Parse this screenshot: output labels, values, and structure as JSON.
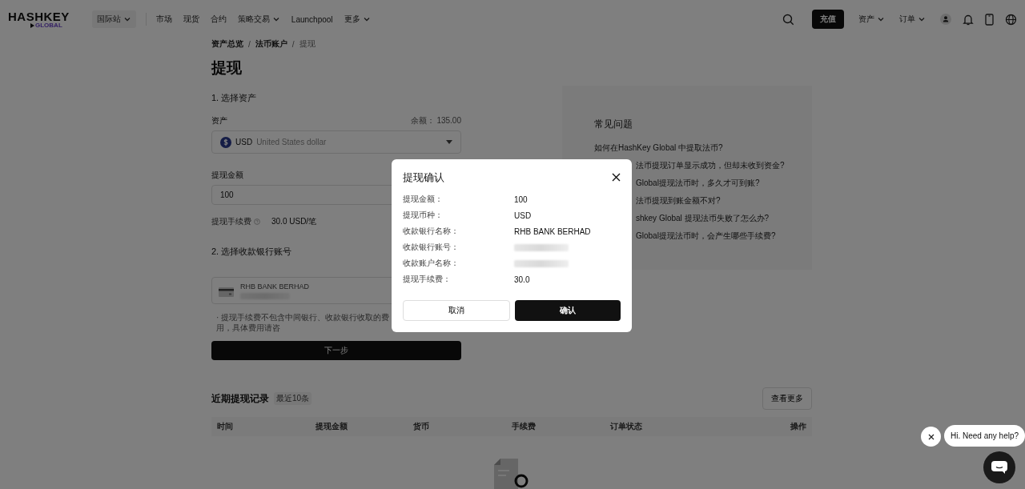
{
  "header": {
    "logo": "HASHKEY",
    "logo_sub": "GLOBAL",
    "site": "国际站",
    "nav": [
      {
        "label": "市场",
        "dropdown": false
      },
      {
        "label": "现货",
        "dropdown": false
      },
      {
        "label": "合约",
        "dropdown": false
      },
      {
        "label": "策略交易",
        "dropdown": true
      },
      {
        "label": "Launchpool",
        "dropdown": false
      },
      {
        "label": "更多",
        "dropdown": true
      }
    ],
    "deposit": "充值",
    "menus": [
      {
        "label": "资产"
      },
      {
        "label": "订单"
      }
    ]
  },
  "breadcrumb": [
    {
      "label": "资产总览",
      "current": false
    },
    {
      "label": "法币账户",
      "current": false
    },
    {
      "label": "提现",
      "current": true
    }
  ],
  "breadcrumb_separators": [
    "/",
    "/"
  ],
  "title": "提现",
  "step1": "1. 选择资产",
  "asset": {
    "label": "资产",
    "balance": "余额： 135.00",
    "code": "USD",
    "name": "United States dollar"
  },
  "amount": {
    "label": "提现金额",
    "value": "100"
  },
  "fee": {
    "label": "提现手续费",
    "value": "30.0 USD/笔"
  },
  "step2": "2. 选择收款银行账号",
  "bank": {
    "name": "RHB BANK BERHAD"
  },
  "note": "· 提现手续费不包含中间银行、收款银行收取的费用，具体费用请咨",
  "next": "下一步",
  "faq": {
    "title": "常见问题",
    "items": [
      {
        "text": "如何在HashKey Global 中提取法币?"
      },
      {
        "text": "法币提现订单显示成功，但却未收到资金?"
      },
      {
        "text": "Global提现法币时，多久才可到账?"
      },
      {
        "text": "法币提现到账金额不对?"
      },
      {
        "text": "shkey Global 提现法币失败了怎么办?"
      },
      {
        "text": "Global提现法币时，会产生哪些手续费?"
      }
    ]
  },
  "records": {
    "title": "近期提现记录",
    "badge": "最近10条",
    "more": "查看更多",
    "columns": [
      "时间",
      "提现金额",
      "货币",
      "手续费",
      "订单状态",
      "操作"
    ]
  },
  "modal": {
    "title": "提现确认",
    "rows": [
      {
        "label": "提现金额：",
        "value": "100",
        "redacted": false
      },
      {
        "label": "提现币种：",
        "value": "USD",
        "redacted": false
      },
      {
        "label": "收款银行名称：",
        "value": "RHB BANK BERHAD",
        "redacted": false
      },
      {
        "label": "收款银行账号：",
        "redacted": true
      },
      {
        "label": "收款账户名称：",
        "redacted": true
      },
      {
        "label": "提现手续费：",
        "value": "30.0",
        "redacted": false
      }
    ],
    "cancel": "取消",
    "confirm": "确认"
  },
  "chat": {
    "message": "Hi. Need any help?"
  }
}
